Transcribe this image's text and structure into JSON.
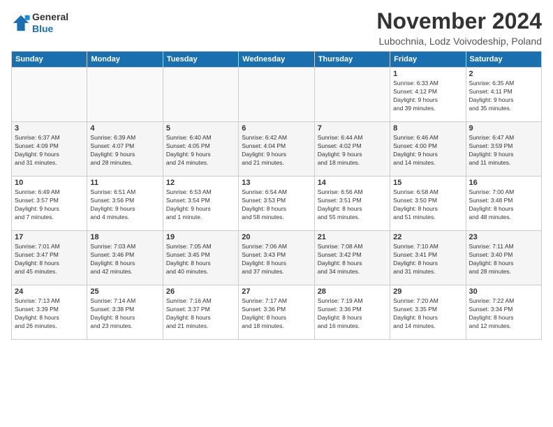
{
  "logo": {
    "line1": "General",
    "line2": "Blue"
  },
  "title": "November 2024",
  "subtitle": "Lubochnia, Lodz Voivodeship, Poland",
  "weekdays": [
    "Sunday",
    "Monday",
    "Tuesday",
    "Wednesday",
    "Thursday",
    "Friday",
    "Saturday"
  ],
  "weeks": [
    [
      {
        "day": "",
        "info": ""
      },
      {
        "day": "",
        "info": ""
      },
      {
        "day": "",
        "info": ""
      },
      {
        "day": "",
        "info": ""
      },
      {
        "day": "",
        "info": ""
      },
      {
        "day": "1",
        "info": "Sunrise: 6:33 AM\nSunset: 4:12 PM\nDaylight: 9 hours\nand 39 minutes."
      },
      {
        "day": "2",
        "info": "Sunrise: 6:35 AM\nSunset: 4:11 PM\nDaylight: 9 hours\nand 35 minutes."
      }
    ],
    [
      {
        "day": "3",
        "info": "Sunrise: 6:37 AM\nSunset: 4:09 PM\nDaylight: 9 hours\nand 31 minutes."
      },
      {
        "day": "4",
        "info": "Sunrise: 6:39 AM\nSunset: 4:07 PM\nDaylight: 9 hours\nand 28 minutes."
      },
      {
        "day": "5",
        "info": "Sunrise: 6:40 AM\nSunset: 4:05 PM\nDaylight: 9 hours\nand 24 minutes."
      },
      {
        "day": "6",
        "info": "Sunrise: 6:42 AM\nSunset: 4:04 PM\nDaylight: 9 hours\nand 21 minutes."
      },
      {
        "day": "7",
        "info": "Sunrise: 6:44 AM\nSunset: 4:02 PM\nDaylight: 9 hours\nand 18 minutes."
      },
      {
        "day": "8",
        "info": "Sunrise: 6:46 AM\nSunset: 4:00 PM\nDaylight: 9 hours\nand 14 minutes."
      },
      {
        "day": "9",
        "info": "Sunrise: 6:47 AM\nSunset: 3:59 PM\nDaylight: 9 hours\nand 11 minutes."
      }
    ],
    [
      {
        "day": "10",
        "info": "Sunrise: 6:49 AM\nSunset: 3:57 PM\nDaylight: 9 hours\nand 7 minutes."
      },
      {
        "day": "11",
        "info": "Sunrise: 6:51 AM\nSunset: 3:56 PM\nDaylight: 9 hours\nand 4 minutes."
      },
      {
        "day": "12",
        "info": "Sunrise: 6:53 AM\nSunset: 3:54 PM\nDaylight: 9 hours\nand 1 minute."
      },
      {
        "day": "13",
        "info": "Sunrise: 6:54 AM\nSunset: 3:53 PM\nDaylight: 8 hours\nand 58 minutes."
      },
      {
        "day": "14",
        "info": "Sunrise: 6:56 AM\nSunset: 3:51 PM\nDaylight: 8 hours\nand 55 minutes."
      },
      {
        "day": "15",
        "info": "Sunrise: 6:58 AM\nSunset: 3:50 PM\nDaylight: 8 hours\nand 51 minutes."
      },
      {
        "day": "16",
        "info": "Sunrise: 7:00 AM\nSunset: 3:48 PM\nDaylight: 8 hours\nand 48 minutes."
      }
    ],
    [
      {
        "day": "17",
        "info": "Sunrise: 7:01 AM\nSunset: 3:47 PM\nDaylight: 8 hours\nand 45 minutes."
      },
      {
        "day": "18",
        "info": "Sunrise: 7:03 AM\nSunset: 3:46 PM\nDaylight: 8 hours\nand 42 minutes."
      },
      {
        "day": "19",
        "info": "Sunrise: 7:05 AM\nSunset: 3:45 PM\nDaylight: 8 hours\nand 40 minutes."
      },
      {
        "day": "20",
        "info": "Sunrise: 7:06 AM\nSunset: 3:43 PM\nDaylight: 8 hours\nand 37 minutes."
      },
      {
        "day": "21",
        "info": "Sunrise: 7:08 AM\nSunset: 3:42 PM\nDaylight: 8 hours\nand 34 minutes."
      },
      {
        "day": "22",
        "info": "Sunrise: 7:10 AM\nSunset: 3:41 PM\nDaylight: 8 hours\nand 31 minutes."
      },
      {
        "day": "23",
        "info": "Sunrise: 7:11 AM\nSunset: 3:40 PM\nDaylight: 8 hours\nand 28 minutes."
      }
    ],
    [
      {
        "day": "24",
        "info": "Sunrise: 7:13 AM\nSunset: 3:39 PM\nDaylight: 8 hours\nand 26 minutes."
      },
      {
        "day": "25",
        "info": "Sunrise: 7:14 AM\nSunset: 3:38 PM\nDaylight: 8 hours\nand 23 minutes."
      },
      {
        "day": "26",
        "info": "Sunrise: 7:16 AM\nSunset: 3:37 PM\nDaylight: 8 hours\nand 21 minutes."
      },
      {
        "day": "27",
        "info": "Sunrise: 7:17 AM\nSunset: 3:36 PM\nDaylight: 8 hours\nand 18 minutes."
      },
      {
        "day": "28",
        "info": "Sunrise: 7:19 AM\nSunset: 3:36 PM\nDaylight: 8 hours\nand 16 minutes."
      },
      {
        "day": "29",
        "info": "Sunrise: 7:20 AM\nSunset: 3:35 PM\nDaylight: 8 hours\nand 14 minutes."
      },
      {
        "day": "30",
        "info": "Sunrise: 7:22 AM\nSunset: 3:34 PM\nDaylight: 8 hours\nand 12 minutes."
      }
    ]
  ]
}
